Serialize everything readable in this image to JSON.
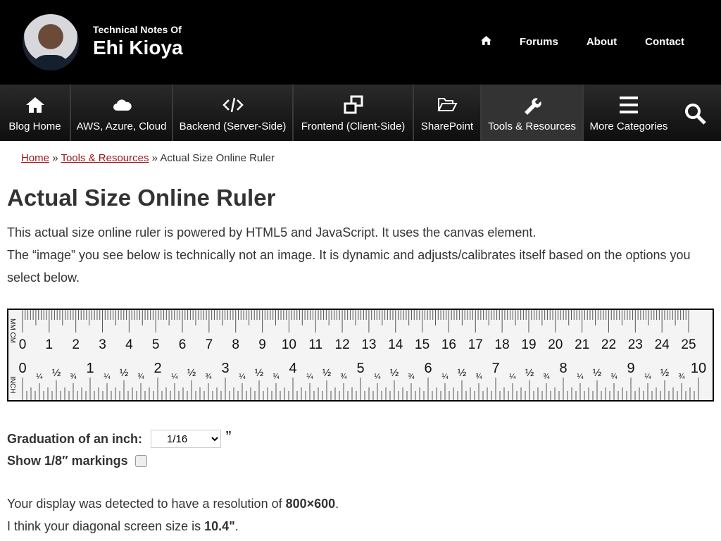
{
  "header": {
    "subtitle": "Technical Notes Of",
    "title": "Ehi Kioya",
    "links": [
      "Forums",
      "About",
      "Contact"
    ]
  },
  "nav": [
    {
      "label": "Blog Home",
      "icon": "home-icon"
    },
    {
      "label": "AWS, Azure, Cloud",
      "icon": "cloud-icon"
    },
    {
      "label": "Backend (Server-Side)",
      "icon": "code-icon"
    },
    {
      "label": "Frontend (Client-Side)",
      "icon": "window-restore-icon"
    },
    {
      "label": "SharePoint",
      "icon": "folder-open-icon"
    },
    {
      "label": "Tools & Resources",
      "icon": "wrench-icon",
      "active": true
    },
    {
      "label": "More Categories",
      "icon": "menu-icon"
    }
  ],
  "breadcrumb": {
    "home": "Home",
    "section": "Tools & Resources",
    "sep": "»",
    "current": "Actual Size Online Ruler"
  },
  "page": {
    "title": "Actual Size Online Ruler",
    "p1": "This actual size online ruler is powered by HTML5 and JavaScript. It uses the canvas element.",
    "p2": "The “image” you see below is technically not an image. It is dynamic and adjusts/calibrates itself based on the options you select below."
  },
  "ruler": {
    "top_label": "MM CM",
    "bottom_label": "INCH",
    "cm_max": 25,
    "inch_max": 10,
    "fractions": [
      "¼",
      "½",
      "¾"
    ]
  },
  "form": {
    "graduation_label": "Graduation of an inch:",
    "graduation_value": "1/16",
    "graduation_unit": "”",
    "eighth_label": "Show 1/8″ markings",
    "eighth_checked": false
  },
  "result": {
    "res_prefix": "Your display was detected to have a resolution of ",
    "res_value": "800×600",
    "res_suffix": ".",
    "size_prefix": "I think your diagonal screen size is ",
    "size_value": "10.4\"",
    "size_suffix": "."
  }
}
